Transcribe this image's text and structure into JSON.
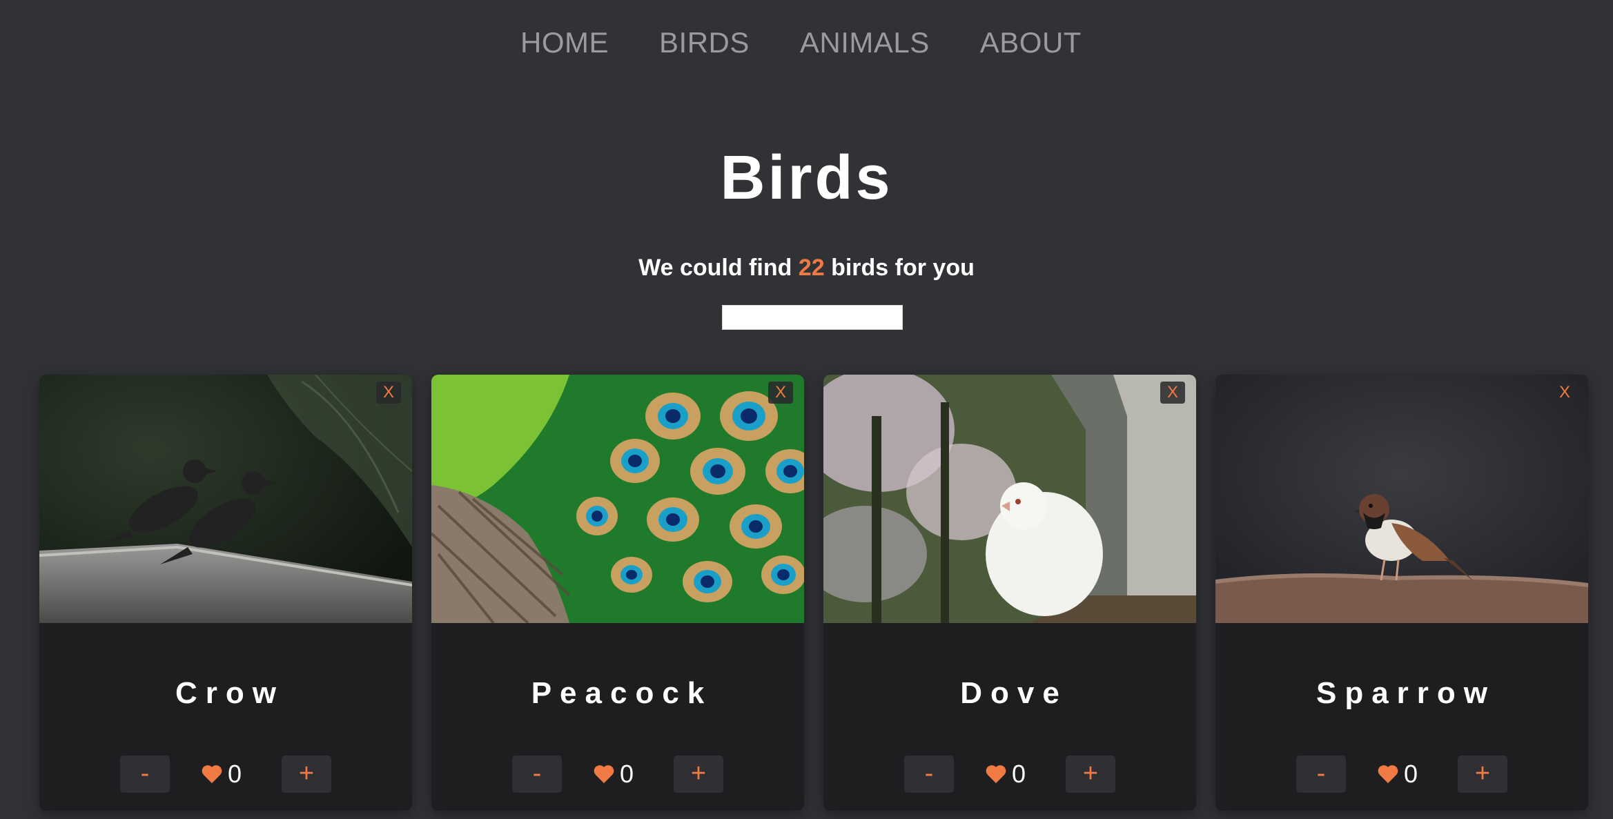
{
  "nav": {
    "items": [
      "HOME",
      "BIRDS",
      "ANIMALS",
      "ABOUT"
    ]
  },
  "header": {
    "title": "Birds",
    "subtitle_prefix": "We could find ",
    "count": "22",
    "subtitle_suffix": " birds for you"
  },
  "search": {
    "value": "",
    "placeholder": ""
  },
  "cards": [
    {
      "name": "Crow",
      "close_label": "X",
      "minus_label": "-",
      "plus_label": "+",
      "likes": "0",
      "image": "crow-photo"
    },
    {
      "name": "Peacock",
      "close_label": "X",
      "minus_label": "-",
      "plus_label": "+",
      "likes": "0",
      "image": "peacock-photo"
    },
    {
      "name": "Dove",
      "close_label": "X",
      "minus_label": "-",
      "plus_label": "+",
      "likes": "0",
      "image": "dove-photo"
    },
    {
      "name": "Sparrow",
      "close_label": "X",
      "minus_label": "-",
      "plus_label": "+",
      "likes": "0",
      "image": "sparrow-photo"
    }
  ],
  "colors": {
    "background": "#313236",
    "card": "#1e1e21",
    "accent": "#f07a44",
    "nav_text": "#9a9ba0"
  },
  "icons": {
    "like": "heart-icon",
    "close": "close-icon"
  }
}
